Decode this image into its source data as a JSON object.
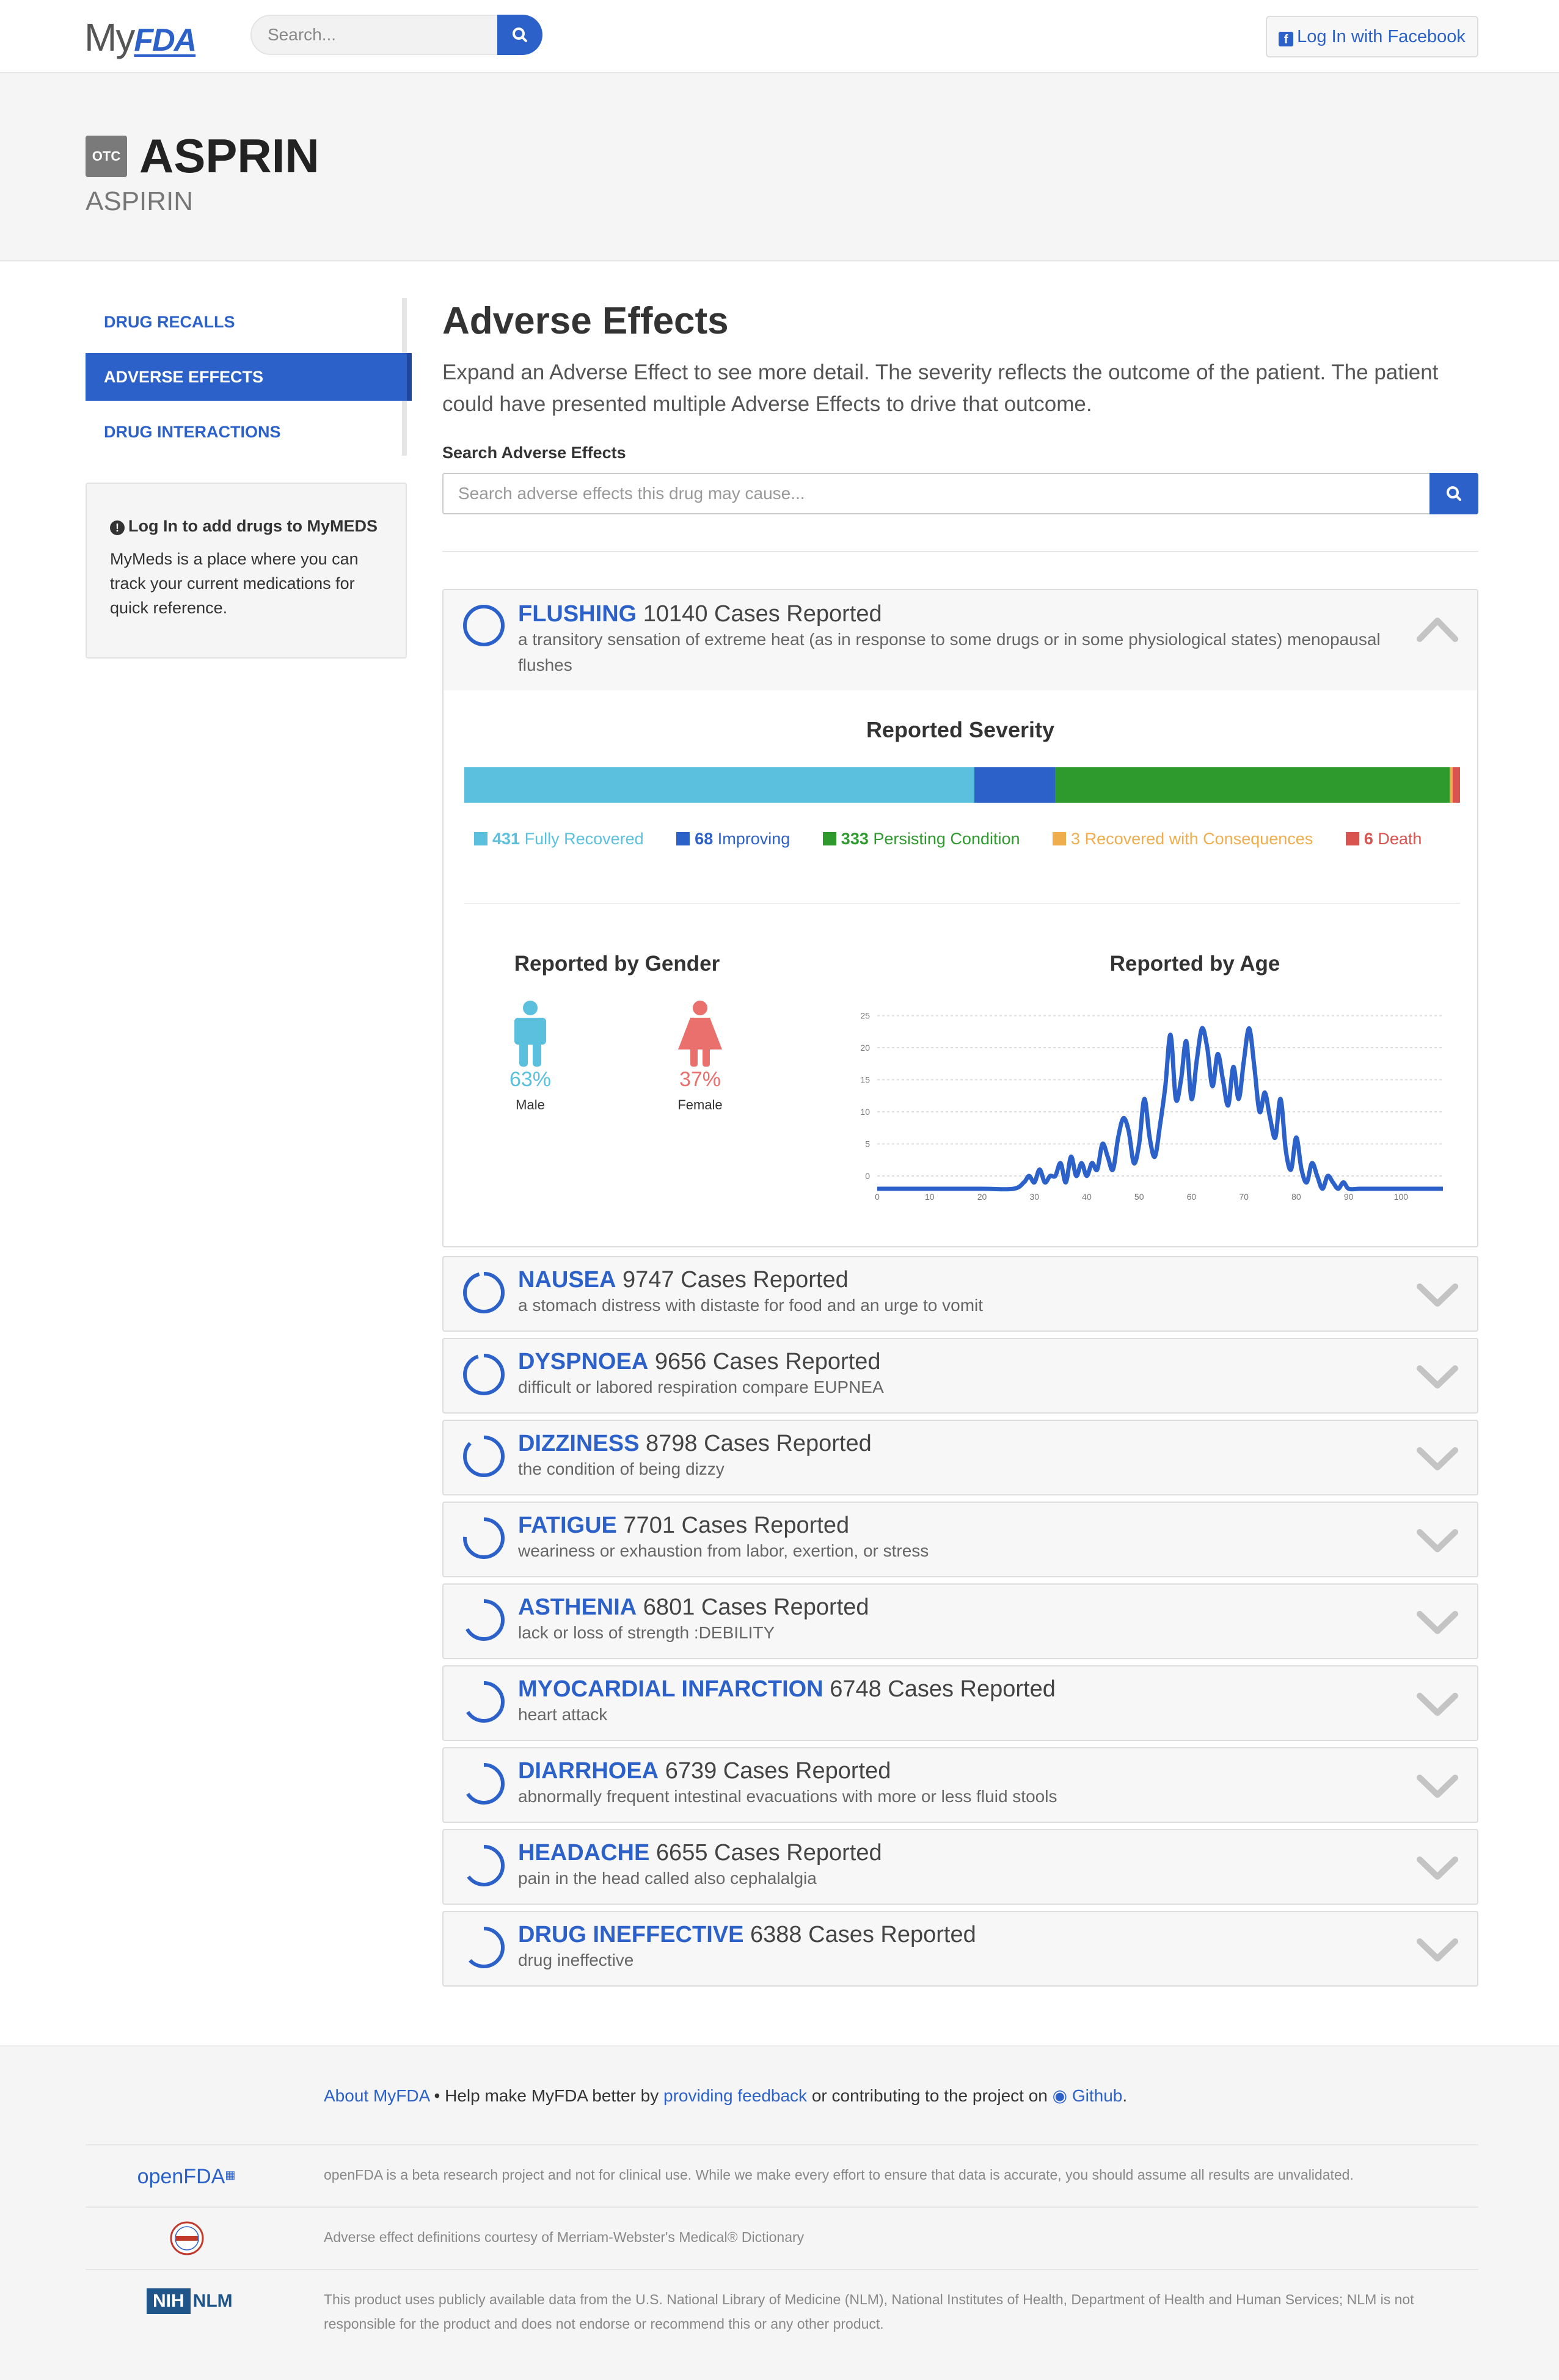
{
  "nav": {
    "logo_my": "My",
    "logo_fda": "FDA",
    "search_placeholder": "Search...",
    "fb_label": "Log In with Facebook"
  },
  "header": {
    "badge": "OTC",
    "title": "ASPRIN",
    "subtitle": "ASPIRIN"
  },
  "sidebar": {
    "items": [
      {
        "label": "DRUG RECALLS"
      },
      {
        "label": "ADVERSE EFFECTS"
      },
      {
        "label": "DRUG INTERACTIONS"
      }
    ],
    "login_title": "Log In to add drugs to MyMEDS",
    "login_text": "MyMeds is a place where you can track your current medications for quick reference."
  },
  "main": {
    "title": "Adverse Effects",
    "description": "Expand an Adverse Effect to see more detail. The severity reflects the outcome of the patient. The patient could have presented multiple Adverse Effects to drive that outcome.",
    "search_label": "Search Adverse Effects",
    "search_placeholder": "Search adverse effects this drug may cause..."
  },
  "expanded": {
    "name": "FLUSHING",
    "cases": "10140 Cases Reported",
    "definition": "a transitory sensation of extreme heat (as in response to some drugs or in some physiological states) menopausal flushes",
    "severity_title": "Reported Severity",
    "severity": [
      {
        "count": "431",
        "label": "Fully Recovered",
        "color": "#5bc0de",
        "value": 431
      },
      {
        "count": "68",
        "label": "Improving",
        "color": "#2c61c9",
        "value": 68
      },
      {
        "count": "333",
        "label": "Persisting Condition",
        "color": "#2e9a2e",
        "value": 333
      },
      {
        "count": "3",
        "label": "Recovered with Consequences",
        "color": "#f0ad4e",
        "value": 3
      },
      {
        "count": "6",
        "label": "Death",
        "color": "#d9534f",
        "value": 6
      }
    ],
    "gender_title": "Reported by Gender",
    "male_pct": "63%",
    "male_label": "Male",
    "female_pct": "37%",
    "female_label": "Female",
    "age_title": "Reported by Age"
  },
  "chart_data": {
    "type": "line",
    "title": "Reported by Age",
    "xlabel": "",
    "ylabel": "",
    "xlim": [
      0,
      108
    ],
    "ylim": [
      -2,
      26
    ],
    "x_ticks": [
      0,
      10,
      20,
      30,
      40,
      50,
      60,
      70,
      80,
      90,
      100
    ],
    "y_ticks": [
      0,
      5,
      10,
      15,
      20,
      25
    ],
    "grid": true,
    "series": [
      {
        "color": "#2c61c9",
        "x": [
          0,
          10,
          20,
          26,
          28,
          29,
          30,
          31,
          32,
          33,
          34,
          35,
          36,
          37,
          38,
          39,
          40,
          41,
          42,
          43,
          44,
          45,
          46,
          47,
          48,
          49,
          50,
          51,
          52,
          53,
          54,
          55,
          56,
          57,
          58,
          59,
          60,
          61,
          62,
          63,
          64,
          65,
          66,
          67,
          68,
          69,
          70,
          71,
          72,
          73,
          74,
          75,
          76,
          77,
          78,
          79,
          80,
          81,
          82,
          83,
          84,
          85,
          86,
          87,
          88,
          89,
          90,
          92,
          94,
          96,
          100,
          108
        ],
        "y": [
          -2,
          -2,
          -2,
          -2,
          -1,
          0,
          -1,
          1,
          -1,
          0,
          0,
          2,
          -1,
          3,
          0,
          2,
          0,
          2,
          1,
          5,
          3,
          1,
          6,
          9,
          7,
          2,
          5,
          12,
          6,
          3,
          8,
          14,
          22,
          12,
          15,
          21,
          12,
          18,
          23,
          20,
          14,
          19,
          15,
          11,
          17,
          12,
          18,
          23,
          17,
          10,
          13,
          9,
          6,
          12,
          4,
          1,
          6,
          1,
          -1,
          2,
          0,
          -2,
          0,
          -1,
          -2,
          -1,
          -2,
          -2,
          -2,
          -2,
          -2,
          -2
        ]
      }
    ]
  },
  "collapsed": [
    {
      "name": "NAUSEA",
      "cases": "9747 Cases Reported",
      "definition": "a stomach distress with distaste for food and an urge to vomit",
      "pct": 0.96
    },
    {
      "name": "DYSPNOEA",
      "cases": "9656 Cases Reported",
      "definition": "difficult or labored respiration compare EUPNEA",
      "pct": 0.95
    },
    {
      "name": "DIZZINESS",
      "cases": "8798 Cases Reported",
      "definition": "the condition of being dizzy",
      "pct": 0.87
    },
    {
      "name": "FATIGUE",
      "cases": "7701 Cases Reported",
      "definition": "weariness or exhaustion from labor, exertion, or stress",
      "pct": 0.76
    },
    {
      "name": "ASTHENIA",
      "cases": "6801 Cases Reported",
      "definition": "lack or loss of strength :DEBILITY",
      "pct": 0.67
    },
    {
      "name": "MYOCARDIAL INFARCTION",
      "cases": "6748 Cases Reported",
      "definition": "heart attack",
      "pct": 0.66
    },
    {
      "name": "DIARRHOEA",
      "cases": "6739 Cases Reported",
      "definition": "abnormally frequent intestinal evacuations with more or less fluid stools",
      "pct": 0.66
    },
    {
      "name": "HEADACHE",
      "cases": "6655 Cases Reported",
      "definition": "pain in the head called also cephalalgia",
      "pct": 0.65
    },
    {
      "name": "DRUG INEFFECTIVE",
      "cases": "6388 Cases Reported",
      "definition": "drug ineffective",
      "pct": 0.63
    }
  ],
  "footer": {
    "about": "About MyFDA",
    "bullet_text": " • Help make MyFDA better by ",
    "feedback": "providing feedback",
    "contrib": " or contributing to the project on ",
    "github": "Github",
    "period": ".",
    "openfda_logo": "openFDA",
    "openfda_text": "openFDA is a beta research project and not for clinical use. While we make every effort to ensure that data is accurate, you should assume all results are unvalidated.",
    "mw_logo": "Merriam-Webster",
    "mw_text": "Adverse effect definitions courtesy of Merriam-Webster's Medical® Dictionary",
    "nih_logo": "NIH",
    "nlm_logo": "NLM",
    "nlm_text": "This product uses publicly available data from the U.S. National Library of Medicine (NLM), National Institutes of Health, Department of Health and Human Services; NLM is not responsible for the product and does not endorse or recommend this or any other product."
  }
}
